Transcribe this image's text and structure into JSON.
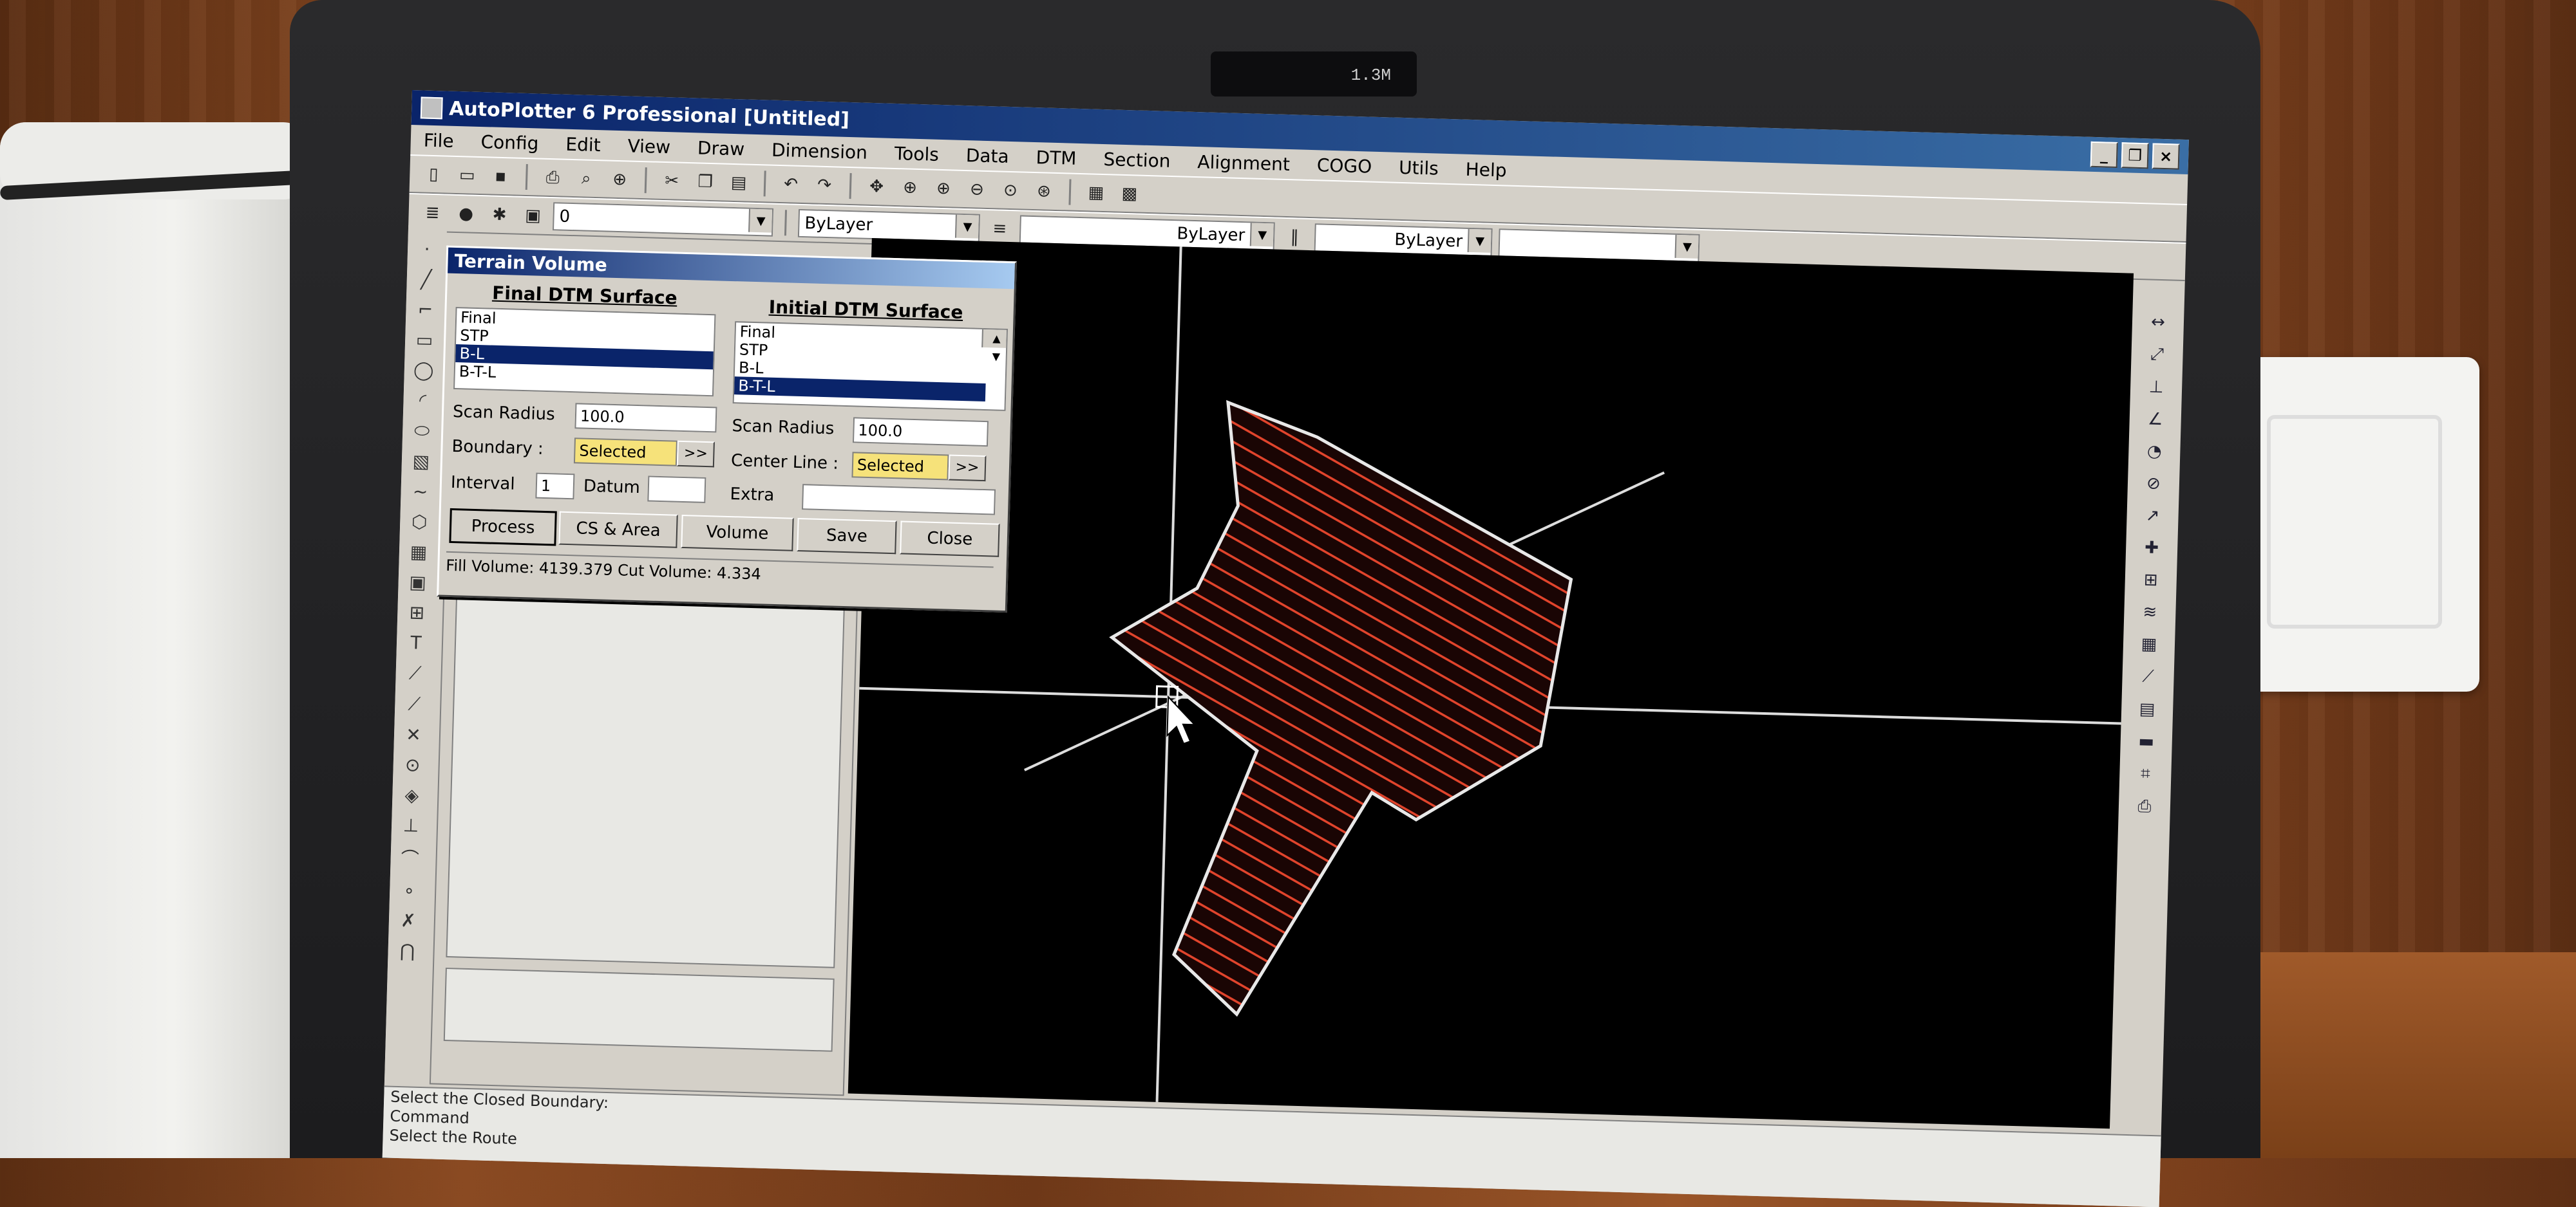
{
  "window": {
    "title": "AutoPlotter 6 Professional [Untitled]",
    "controls": [
      "_",
      "❐",
      "×"
    ]
  },
  "camera_label": "1.3M",
  "menubar": [
    "File",
    "Config",
    "Edit",
    "View",
    "Draw",
    "Dimension",
    "Tools",
    "Data",
    "DTM",
    "Section",
    "Alignment",
    "COGO",
    "Utils",
    "Help"
  ],
  "toolbar": {
    "layer_value": "0",
    "color_value": "ByLayer",
    "linetype_value": "ByLayer",
    "lineweight_value": "ByLayer"
  },
  "dialog": {
    "title": "Terrain Volume",
    "final": {
      "heading": "Final DTM Surface",
      "items": [
        "Final",
        "STP",
        "B-L",
        "B-T-L"
      ],
      "selected_index": 2,
      "scan_radius_label": "Scan Radius",
      "scan_radius_value": "100.0",
      "boundary_label": "Boundary :",
      "boundary_value": "Selected",
      "pick_label": ">>",
      "interval_label": "Interval",
      "interval_value": "1",
      "datum_label": "Datum",
      "datum_value": ""
    },
    "initial": {
      "heading": "Initial DTM Surface",
      "items": [
        "Final",
        "STP",
        "B-L",
        "B-T-L"
      ],
      "selected_index": 3,
      "scan_radius_label": "Scan Radius",
      "scan_radius_value": "100.0",
      "centerline_label": "Center Line :",
      "centerline_value": "Selected",
      "pick_label": ">>",
      "extra_label": "Extra",
      "extra_value": ""
    },
    "buttons": {
      "process": "Process",
      "cs_area": "CS & Area",
      "volume": "Volume",
      "save": "Save",
      "close": "Close"
    },
    "result": "Fill Volume: 4139.379 Cut Volume: 4.334"
  },
  "command": {
    "line1": "Select the Closed Boundary:",
    "line2": "Command",
    "line3": "Select the Route"
  },
  "colors": {
    "hatch": "#e0442c",
    "outline": "#e8e8e8",
    "canvas": "#000000",
    "titlebar": "#0a246a"
  }
}
